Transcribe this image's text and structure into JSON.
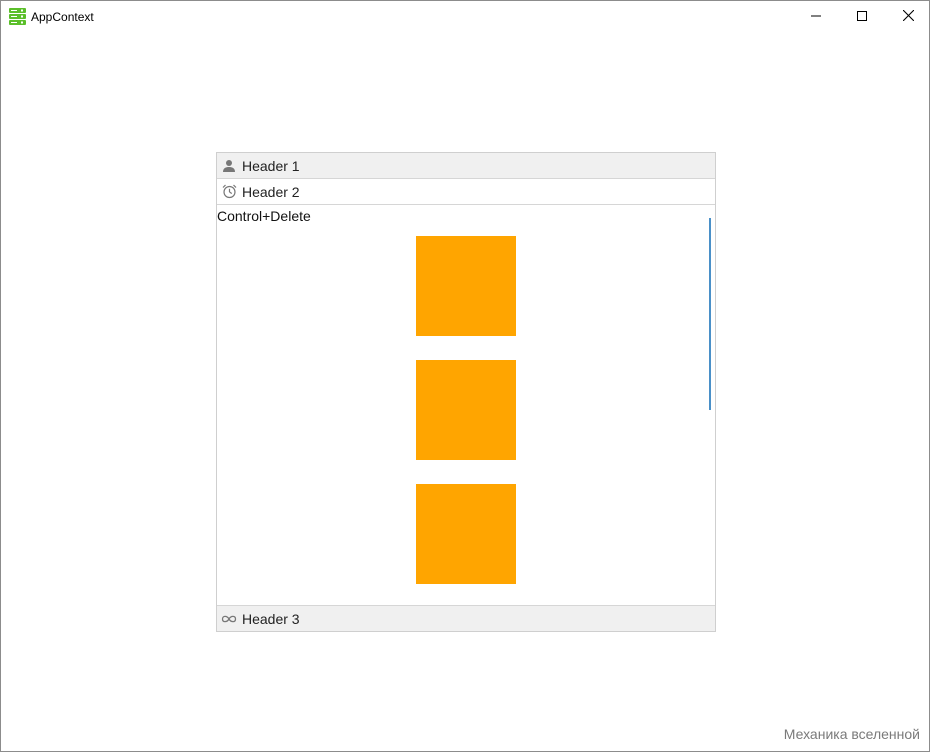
{
  "window": {
    "title": "AppContext",
    "icons": {
      "app": "server-stack-icon",
      "minimize": "minimize-icon",
      "maximize": "maximize-icon",
      "close": "close-icon"
    }
  },
  "accordion": {
    "headers": [
      {
        "label": "Header 1",
        "icon": "person-icon"
      },
      {
        "label": "Header 2",
        "icon": "alarm-clock-icon"
      },
      {
        "label": "Header 3",
        "icon": "infinity-icon"
      }
    ],
    "expanded_index": 1,
    "content": {
      "label": "Control+Delete",
      "square_color": "#FFA500",
      "square_count_visible": 3
    }
  },
  "footer": {
    "text": "Механика вселенной"
  },
  "colors": {
    "accent_scroll": "#4A90C8",
    "header_bg": "#F0F0F0",
    "app_icon_green": "#5BBF2A"
  }
}
